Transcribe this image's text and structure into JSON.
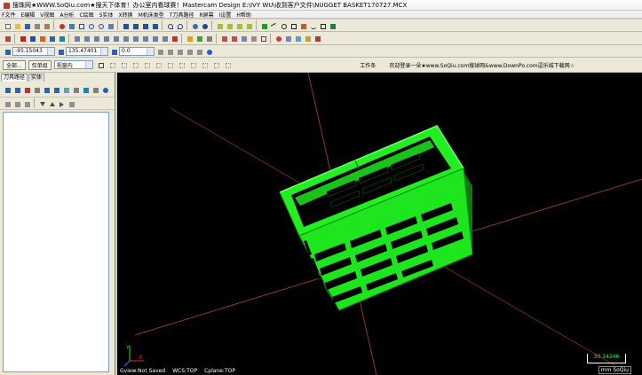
{
  "window": {
    "title": "搜珠网★WWW.SoQiu.com★搜天下体育！办公室内看球赛！Mastercam Design  E:\\IVY WU\\收到客户文件\\NUGGET BASKET170727.MCX"
  },
  "menu": {
    "items": [
      "F文件",
      "E编辑",
      "V视图",
      "A分析",
      "C绘图",
      "S实体",
      "X转换",
      "M机床类型",
      "T刀具路径",
      "R屏幕",
      "I设置",
      "H帮助"
    ]
  },
  "toolbar3": {
    "x_value": "-95.15043",
    "y_value": "135.47401",
    "z_value": "0.0"
  },
  "toolbar4": {
    "all_label": "全部...",
    "single_label": "仅单组",
    "view_select": "视窗内",
    "work_label": "工作条",
    "banner_text": "欢迎登录一朵★www.SoQiu.com搜球网&www.DownPo.com逗乐城下载网☆"
  },
  "left_panel": {
    "tabs": [
      "刀具路径",
      "实体"
    ]
  },
  "viewport": {
    "gview": "Gview:Not Saved",
    "wcs": "WCS:TOP",
    "cplane": "Cplane:TOP",
    "scale_value": "30.14246",
    "units": "mm  SoQiu"
  },
  "colors": {
    "model": "#1ef01e",
    "model_dark": "#0a8a0a",
    "axis_line": "#8a3a2a",
    "viewport_bg": "#000000"
  }
}
